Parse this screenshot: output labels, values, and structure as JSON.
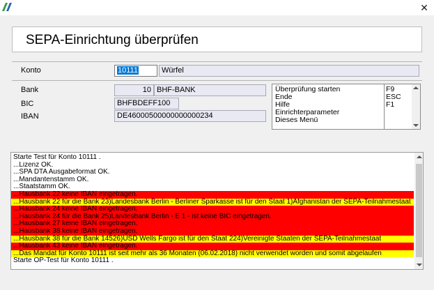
{
  "window": {
    "logo_icon": "app-logo-icon",
    "close_label": "✕"
  },
  "header": {
    "title": "SEPA-Einrichtung überprüfen"
  },
  "konto": {
    "label": "Konto",
    "number": "10111",
    "name": "Würfel"
  },
  "bank": {
    "label": "Bank",
    "number": "10",
    "name": "BHF-BANK"
  },
  "bic": {
    "label": "BIC",
    "value": "BHFBDEFF100"
  },
  "iban": {
    "label": "IBAN",
    "value": "DE46000500000000000234"
  },
  "commands": [
    {
      "label": "Überprüfung starten",
      "key": "F9"
    },
    {
      "label": "Ende",
      "key": "ESC"
    },
    {
      "label": "Hilfe",
      "key": "F1"
    },
    {
      "label": "Einrichterparameter",
      "key": ""
    },
    {
      "label": "Dieses Menü",
      "key": ""
    }
  ],
  "log": [
    {
      "text": "Starte Test für Konto 10111 .",
      "color": "none"
    },
    {
      "text": "...Lizenz   OK.",
      "color": "none"
    },
    {
      "text": "...SPA DTA Ausgabeformat   OK.",
      "color": "none"
    },
    {
      "text": "...Mandantenstamm   OK.",
      "color": "none"
    },
    {
      "text": "...Staatstamm   OK.",
      "color": "none"
    },
    {
      "text": "...Hausbank 22 keine IBAN eingetragen.",
      "color": "red"
    },
    {
      "text": "...Hausbank 22 für die Bank 23)Landesbank Berlin - Berliner Sparkasse ist für den Staat 1)Afghanistan der SEPA-Teilnahmestaat",
      "color": "yellow"
    },
    {
      "text": "...Hausbank 24 keine IBAN eingetragen.",
      "color": "red"
    },
    {
      "text": "...Hausbank 24 für die Bank 25)Landesbank Berlin - E 1 - ist keine BIC eingetragen.",
      "color": "red"
    },
    {
      "text": "...Hausbank 27 keine IBAN eingetragen.",
      "color": "red"
    },
    {
      "text": "...Hausbank 38 keine IBAN eingetragen.",
      "color": "red"
    },
    {
      "text": "...Hausbank 38 für die Bank 14526)USD Wells Fargo ist für den Staat 224)Vereinigte Staaten der SEPA-Teilnahmestaat",
      "color": "yellow"
    },
    {
      "text": "...Hausbank 43 keine IBAN eingetragen.",
      "color": "red"
    },
    {
      "text": "...Das Mandat für Konto 10111  ist seit mehr als 36 Monaten (06.02.2018) nicht verwendet worden und somit abgelaufen",
      "color": "yellow"
    },
    {
      "text": "Starte OP-Test für Konto 10111 .",
      "color": "none"
    }
  ]
}
